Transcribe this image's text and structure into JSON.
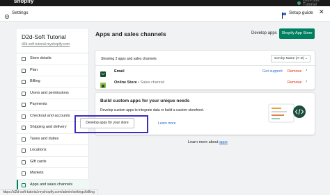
{
  "topbar": {
    "brand": "shopify",
    "store_short": "D2d-Soft Tutorial"
  },
  "header": {
    "title": "Settings",
    "setup_guide": "Setup guide"
  },
  "sidebar": {
    "store_name": "D2d-Soft Tutorial",
    "store_url": "d2d-soft-tutorial.myshopify.com",
    "items": [
      {
        "label": "Store details"
      },
      {
        "label": "Plan"
      },
      {
        "label": "Billing"
      },
      {
        "label": "Users and permissions"
      },
      {
        "label": "Payments"
      },
      {
        "label": "Checkout and accounts"
      },
      {
        "label": "Shipping and delivery"
      },
      {
        "label": "Taxes and duties"
      },
      {
        "label": "Locations"
      },
      {
        "label": "Gift cards"
      },
      {
        "label": "Markets"
      },
      {
        "label": "Apps and sales channels"
      }
    ]
  },
  "status_bar": {
    "url": "https://d2d-soft-tutorial.myshopify.com/admin/settings/billing"
  },
  "main": {
    "title": "Apps and sales channels",
    "develop_apps_link": "Develop apps",
    "shopify_app_store_button": "Shopify App Store",
    "list": {
      "showing_text": "Showing 2 apps and sales channels",
      "sort_label": "Sort by Name (A–Z)",
      "rows": [
        {
          "name": "Email",
          "sub": "",
          "support": "Get support",
          "remove": "Remove"
        },
        {
          "name": "Online Store",
          "sub": " • Sales channel",
          "support": "",
          "remove": "Remove"
        }
      ]
    },
    "custom": {
      "heading": "Build custom apps for your unique needs",
      "description": "Develop custom apps to integrate data or build a custom storefront.",
      "develop_button": "Develop apps for your store",
      "learn_more": "Learn more"
    },
    "footer": {
      "prefix": "Learn more about ",
      "link": "apps"
    }
  },
  "colors": {
    "accent": "#008060",
    "link": "#2c6ecb",
    "danger": "#d72c0d",
    "highlight": "#3c2dbf"
  }
}
